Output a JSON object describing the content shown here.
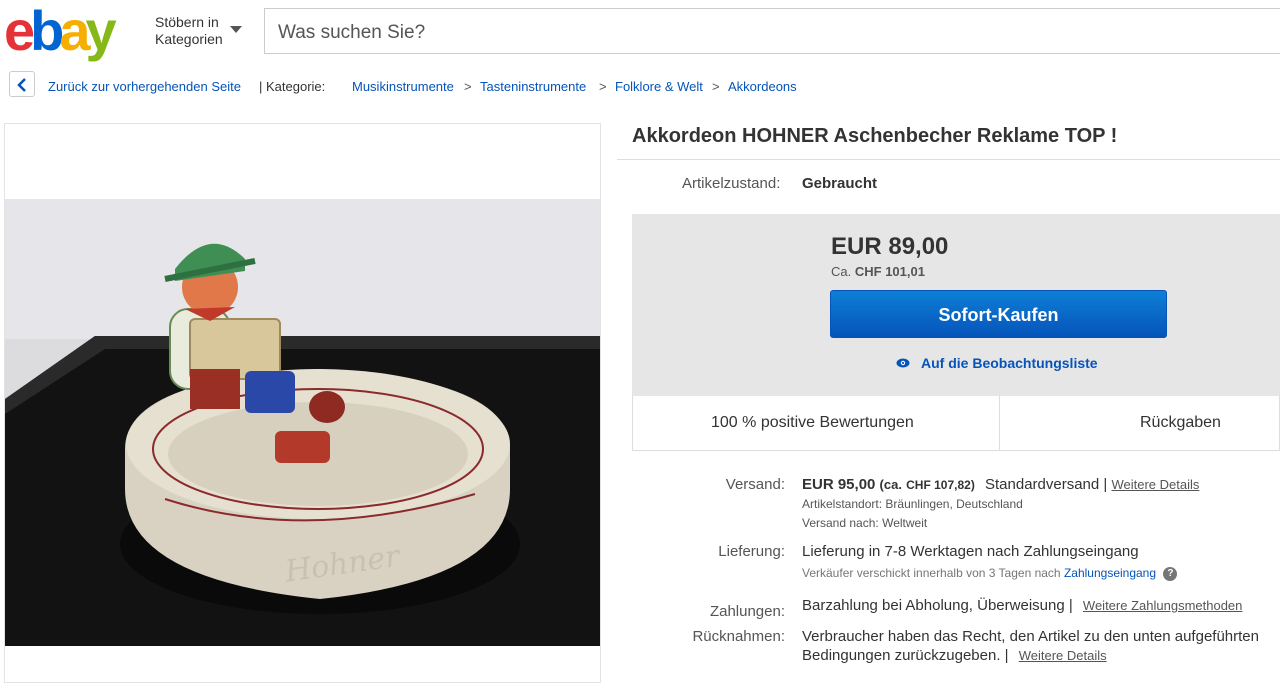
{
  "header": {
    "logo_letters": [
      "e",
      "b",
      "a",
      "y"
    ],
    "browse_line1": "Stöbern in",
    "browse_line2": "Kategorien",
    "search_placeholder": "Was suchen Sie?"
  },
  "breadcrumb": {
    "back_label": "Zurück zur vorhergehenden Seite",
    "category_label": "| Kategorie:",
    "items": [
      "Musikinstrumente",
      "Tasteninstrumente",
      "Folklore & Welt",
      "Akkordeons"
    ],
    "separator": ">"
  },
  "listing": {
    "title": "Akkordeon HOHNER Aschenbecher Reklame TOP !",
    "condition_label": "Artikelzustand:",
    "condition_value": "Gebraucht",
    "price": "EUR 89,00",
    "approx_prefix": "Ca.",
    "approx_value": "CHF 101,01",
    "buy_now_label": "Sofort-Kaufen",
    "watch_label": "Auf die Beobachtungsliste",
    "stat_feedback": "100 % positive Bewertungen",
    "stat_returns": "Rückgaben"
  },
  "shipping": {
    "label": "Versand:",
    "price": "EUR 95,00",
    "approx_open": "(ca.",
    "approx_value": "CHF 107,82)",
    "service": "Standardversand |",
    "details_link": "Weitere Details",
    "location_label": "Artikelstandort:",
    "location_value": "Bräunlingen, Deutschland",
    "ships_to_label": "Versand nach:",
    "ships_to_value": "Weltweit"
  },
  "delivery": {
    "label": "Lieferung:",
    "value": "Lieferung in 7-8 Werktagen nach Zahlungseingang",
    "note": "Verkäufer verschickt innerhalb von 3 Tagen nach",
    "note_link": "Zahlungseingang",
    "help_glyph": "?"
  },
  "payment": {
    "label": "Zahlungen:",
    "value": "Barzahlung bei Abholung,  Überweisung  |",
    "link": "Weitere Zahlungsmethoden"
  },
  "returns": {
    "label": "Rücknahmen:",
    "line1": "Verbraucher haben das Recht, den Artikel zu den unten aufgeführten",
    "line2": "Bedingungen zurückzugeben. |",
    "link": "Weitere Details"
  },
  "colors": {
    "ebay_red": "#e53238",
    "ebay_blue": "#0064d2",
    "ebay_yellow": "#f5af02",
    "ebay_green": "#86b817",
    "link_blue": "#0654ba"
  }
}
